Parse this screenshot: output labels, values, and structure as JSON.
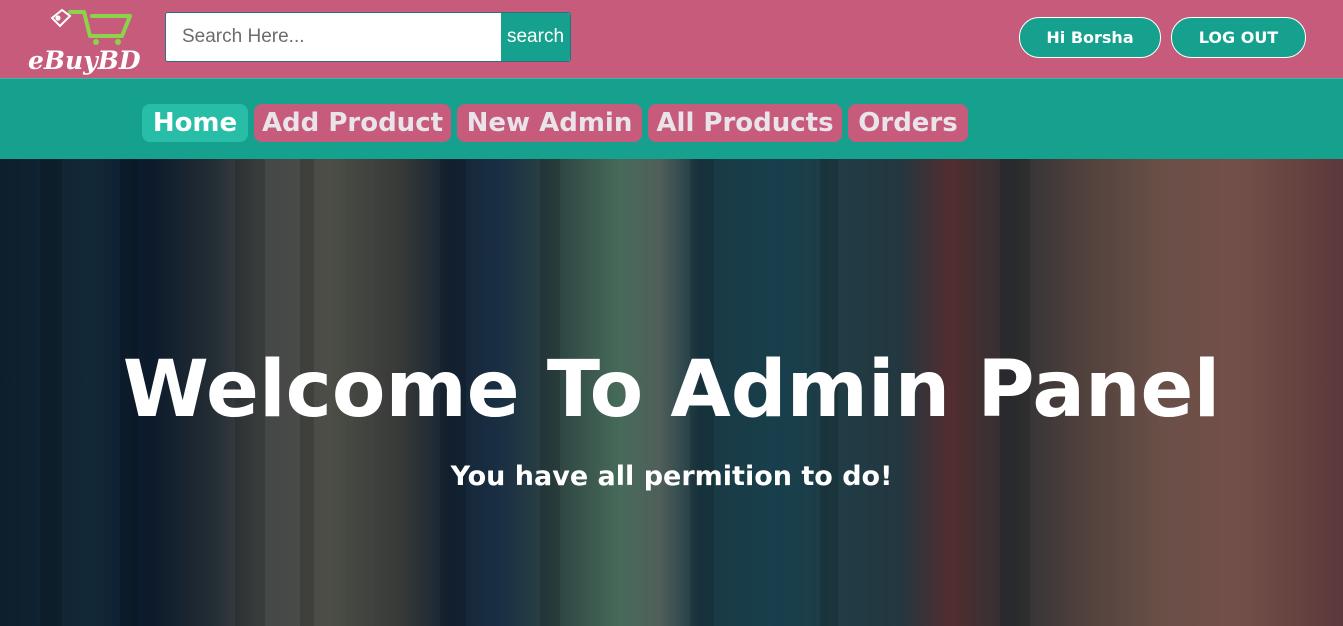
{
  "header": {
    "logo_text": "eBuyBD",
    "search": {
      "placeholder": "Search Here...",
      "value": "",
      "button_label": "search"
    },
    "greeting_label": "Hi Borsha",
    "logout_label": "LOG OUT"
  },
  "nav": {
    "items": [
      {
        "label": "Home",
        "active": true
      },
      {
        "label": "Add Product",
        "active": false
      },
      {
        "label": "New Admin",
        "active": false
      },
      {
        "label": "All Products",
        "active": false
      },
      {
        "label": "Orders",
        "active": false
      }
    ]
  },
  "hero": {
    "title": "Welcome To Admin Panel",
    "subtitle": "You have all permition to do!"
  },
  "colors": {
    "header_bg": "#c65b7c",
    "nav_bg": "#16a18e",
    "accent_teal": "#16a18e",
    "nav_item_bg": "#c65b7c",
    "nav_active_bg": "#27bda7",
    "logo_cart": "#8bd34a"
  },
  "icons": {
    "logo": "shopping-cart-icon"
  }
}
